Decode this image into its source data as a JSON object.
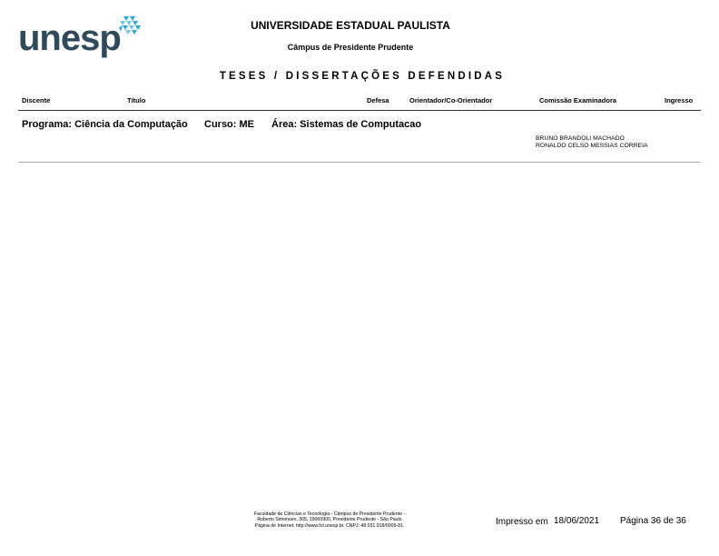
{
  "logo": {
    "text": "unesp",
    "accent_color": "#29a8e0",
    "text_color": "#2f4a5a"
  },
  "header": {
    "university": "UNIVERSIDADE ESTADUAL PAULISTA",
    "campus": "Câmpus de Presidente Prudente",
    "report_title": "TESES / DISSERTAÇÕES DEFENDIDAS"
  },
  "columns": {
    "discente": "Discente",
    "titulo": "Título",
    "defesa": "Defesa",
    "orientador": "Orientador/Co-Orientador",
    "comissao": "Comissão Examinadora",
    "ingresso": "Ingresso"
  },
  "program": {
    "programa": "Programa: Ciência da Computação",
    "curso": "Curso: ME",
    "area": "Área: Sistemas de Computacao"
  },
  "committee": [
    "BRUNO BRANDOLI MACHADO",
    "RONALDO CELSO MESSIAS CORREIA"
  ],
  "footer": {
    "address_lines": [
      "Faculdade de Ciências e Tecnologia - Câmpus de Presidente Prudente -",
      "Roberto Simonsen, 305, 19060900, Presidente Prudente - São Paulo",
      "Página de Internet: http://www.fct.unesp.br. CNPJ: 48.031.918/0009-81."
    ],
    "printed_label": "Impresso em",
    "printed_date": "18/06/2021",
    "page_label": "Página 36 de  36"
  }
}
